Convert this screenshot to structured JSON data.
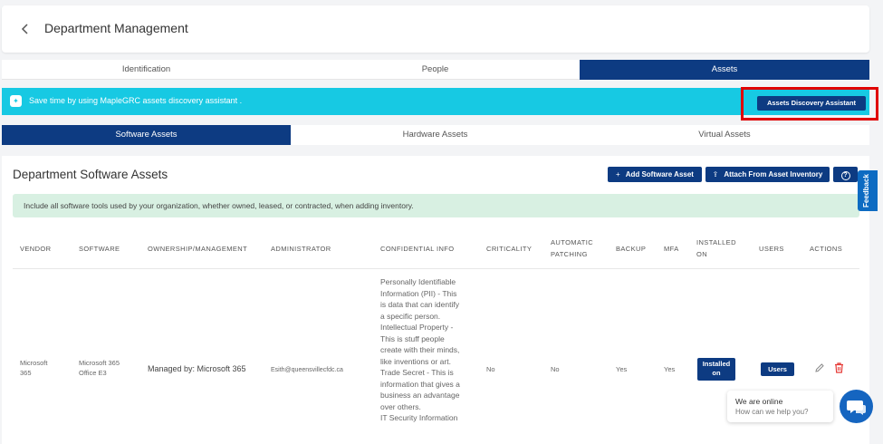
{
  "header": {
    "back_icon": "chevron-left-icon",
    "title": "Department Management"
  },
  "top_tabs": [
    {
      "label": "Identification",
      "active": false
    },
    {
      "label": "People",
      "active": false
    },
    {
      "label": "Assets",
      "active": true
    }
  ],
  "banner": {
    "text": "Save time by using MapleGRC assets discovery assistant .",
    "button_label": "Assets Discovery Assistant"
  },
  "sub_tabs": [
    {
      "label": "Software Assets",
      "active": true
    },
    {
      "label": "Hardware Assets",
      "active": false
    },
    {
      "label": "Virtual Assets",
      "active": false
    }
  ],
  "card": {
    "title": "Department Software Assets",
    "add_button": "Add Software Asset",
    "attach_button": "Attach From Asset Inventory",
    "help_icon": "question-circle-icon",
    "info_text": "Include all software tools used by your organization, whether owned, leased, or contracted, when adding inventory."
  },
  "table": {
    "columns": {
      "vendor": "VENDOR",
      "software": "SOFTWARE",
      "ownership": "OWNERSHIP/MANAGEMENT",
      "administrator": "ADMINISTRATOR",
      "confidential": "CONFIDENTIAL INFO",
      "criticality": "CRITICALITY",
      "patching_1": "AUTOMATIC",
      "patching_2": "PATCHING",
      "backup": "BACKUP",
      "mfa": "MFA",
      "installed_1": "INSTALLED",
      "installed_2": "ON",
      "users": "USERS",
      "actions": "ACTIONS"
    },
    "row": {
      "vendor_1": "Microsoft",
      "vendor_2": "365",
      "software_1": "Microsoft 365",
      "software_2": "Office E3",
      "ownership": "Managed by: Microsoft 365",
      "administrator": "Esith@queensvillecfdc.ca",
      "confidential_lines": [
        "Personally Identifiable",
        "Information (PII) - This",
        "is data that can identify",
        "a specific person.",
        "Intellectual Property -",
        "This is stuff people",
        "create with their minds,",
        "like inventions or art.",
        "Trade Secret - This is",
        "information that gives a",
        "business an advantage",
        "over others.",
        "IT Security Information"
      ],
      "criticality": "No",
      "patching": "No",
      "backup": "Yes",
      "mfa": "Yes",
      "installed_btn_1": "Installed",
      "installed_btn_2": "on",
      "users_btn": "Users",
      "edit_icon": "pencil-icon",
      "delete_icon": "trash-icon"
    }
  },
  "feedback_label": "Feedback",
  "chat": {
    "status": "We are online",
    "prompt": "How can we help you?",
    "icon": "chat-bubble-icon"
  },
  "colors": {
    "primary": "#0d3b82",
    "banner": "#17c9e3",
    "highlight": "#e00000",
    "info_bg": "#d8f0e2",
    "delete": "#e53935"
  }
}
